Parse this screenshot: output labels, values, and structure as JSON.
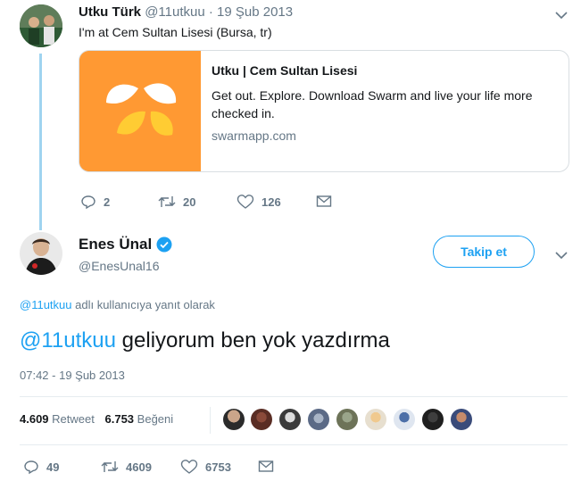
{
  "tweet1": {
    "name": "Utku Türk",
    "handle": "@11utkuu",
    "separator": "·",
    "date": "19 Şub 2013",
    "text": "I'm at Cem Sultan Lisesi (Bursa, tr)",
    "card": {
      "title": "Utku | Cem Sultan Lisesi",
      "description": "Get out. Explore. Download Swarm and live your life more checked in.",
      "domain": "swarmapp.com"
    },
    "actions": {
      "replies": "2",
      "retweets": "20",
      "likes": "126"
    }
  },
  "tweet2": {
    "name": "Enes Ünal",
    "handle": "@EnesUnal16",
    "follow_label": "Takip et",
    "reply_to_handle": "@11utkuu",
    "reply_to_suffix": "adlı kullanıcıya yanıt olarak",
    "mention": "@11utkuu",
    "text": "geliyorum ben yok yazdırma",
    "timestamp": "07:42 - 19 Şub 2013",
    "stats": {
      "retweet_count": "4.609",
      "retweet_label": "Retweet",
      "like_count": "6.753",
      "like_label": "Beğeni"
    },
    "actions": {
      "replies": "49",
      "retweets": "4609",
      "likes": "6753"
    }
  },
  "colors": {
    "accent": "#1da1f2",
    "swarm_orange": "#ff9933",
    "verified": "#1da1f2"
  }
}
